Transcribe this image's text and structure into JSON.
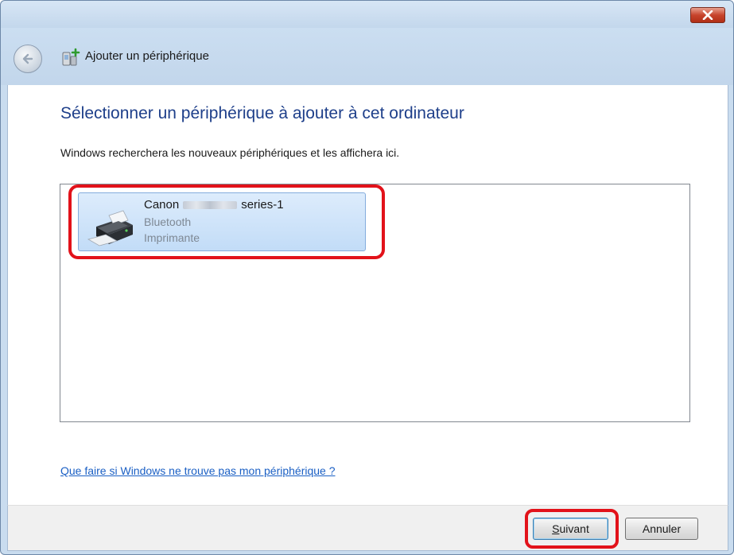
{
  "window": {
    "title": "Ajouter un périphérique"
  },
  "content": {
    "heading": "Sélectionner un périphérique à ajouter à cet ordinateur",
    "instruction": "Windows recherchera les nouveaux périphériques et les affichera ici.",
    "devices": [
      {
        "name_prefix": "Canon",
        "name_suffix": "series-1",
        "connection": "Bluetooth",
        "type": "Imprimante"
      }
    ],
    "help_link": "Que faire si Windows ne trouve pas mon périphérique ?"
  },
  "footer": {
    "next_label": "Suivant",
    "cancel_label": "Annuler"
  },
  "colors": {
    "heading": "#1e3f8a",
    "link": "#1a5fc4",
    "highlight": "#e2121a",
    "selection": "#c2dcf7"
  },
  "icons": {
    "close": "close-icon",
    "back": "back-arrow-icon",
    "title": "add-device-icon",
    "printer": "printer-icon"
  }
}
